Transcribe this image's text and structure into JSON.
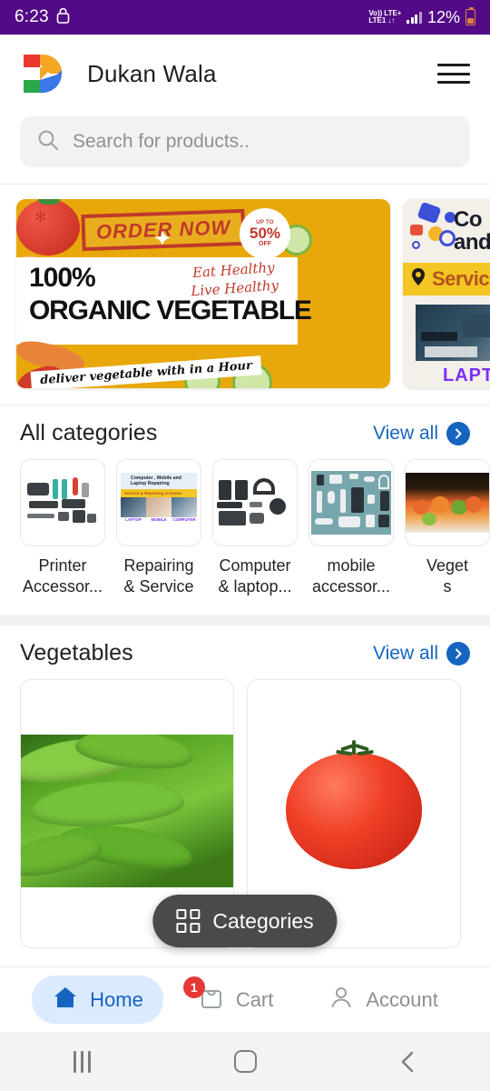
{
  "status_bar": {
    "time": "6:23",
    "lock_icon": "lock-icon",
    "volte_line1": "Vo))",
    "volte_line2": "LTE1",
    "network_type": "LTE+",
    "data_arrows": "↓↑",
    "battery_percent": "12%"
  },
  "header": {
    "app_title": "Dukan Wala",
    "logo_icon": "dukan-wala-logo",
    "menu_icon": "hamburger-menu-icon"
  },
  "search": {
    "placeholder": "Search for products..",
    "value": "",
    "icon": "search-icon"
  },
  "banners": [
    {
      "id": "organic-vegetable-banner",
      "stamp": "ORDER NOW",
      "badge_up_to": "UP TO",
      "badge_percent": "50%",
      "badge_off": "OFF",
      "headline_top": "100%",
      "headline_bottom": "ORGANIC VEGETABLE",
      "script_line1": "Eat Healthy",
      "script_line2": "Live Healthy",
      "ribbon": "deliver vegetable with in a Hour",
      "bg_color": "#e8a80b"
    },
    {
      "id": "computer-service-banner",
      "title_line1": "Co",
      "title_line2": "and",
      "service_text": "Servic",
      "footer_text": "LAPT",
      "pin_icon": "location-pin-icon",
      "bg_color": "#f3efe9"
    }
  ],
  "categories_section": {
    "title": "All categories",
    "view_all_label": "View all",
    "view_all_icon": "chevron-right-circle-icon",
    "items": [
      {
        "label_line1": "Printer",
        "label_line2": "Accessor...",
        "thumb": "printer-accessories-thumb"
      },
      {
        "label_line1": "Repairing",
        "label_line2": "& Service",
        "thumb": "repairing-service-thumb",
        "thumb_text_top": "Computer , Mobile and Laptop Repairing",
        "thumb_text_mid": "Service & Repairing at Home",
        "thumb_tags": [
          "LAPTOP",
          "MOBILE",
          "COMPUTER"
        ]
      },
      {
        "label_line1": "Computer",
        "label_line2": "& laptop...",
        "thumb": "computer-laptop-thumb"
      },
      {
        "label_line1": "mobile",
        "label_line2": "accessor...",
        "thumb": "mobile-accessories-thumb"
      },
      {
        "label_line1": "Veget",
        "label_line2": "s",
        "thumb": "vegetables-thumb"
      }
    ]
  },
  "vegetables_section": {
    "title": "Vegetables",
    "view_all_label": "View all",
    "view_all_icon": "chevron-right-circle-icon",
    "products": [
      {
        "image": "green-pea-pods-image"
      },
      {
        "image": "red-tomato-image"
      }
    ]
  },
  "floating_button": {
    "label": "Categories",
    "icon": "grid-icon",
    "bg_color": "#4a4a4a"
  },
  "bottom_nav": {
    "items": [
      {
        "label": "Home",
        "icon": "home-icon",
        "active": true
      },
      {
        "label": "Cart",
        "icon": "cart-icon",
        "badge": "1",
        "active": false
      },
      {
        "label": "Account",
        "icon": "person-icon",
        "active": false
      }
    ],
    "active_color": "#1565c0",
    "badge_color": "#e53935"
  },
  "android_nav": {
    "recents_icon": "recents-icon",
    "home_icon": "home-square-icon",
    "back_icon": "back-chevron-icon"
  }
}
